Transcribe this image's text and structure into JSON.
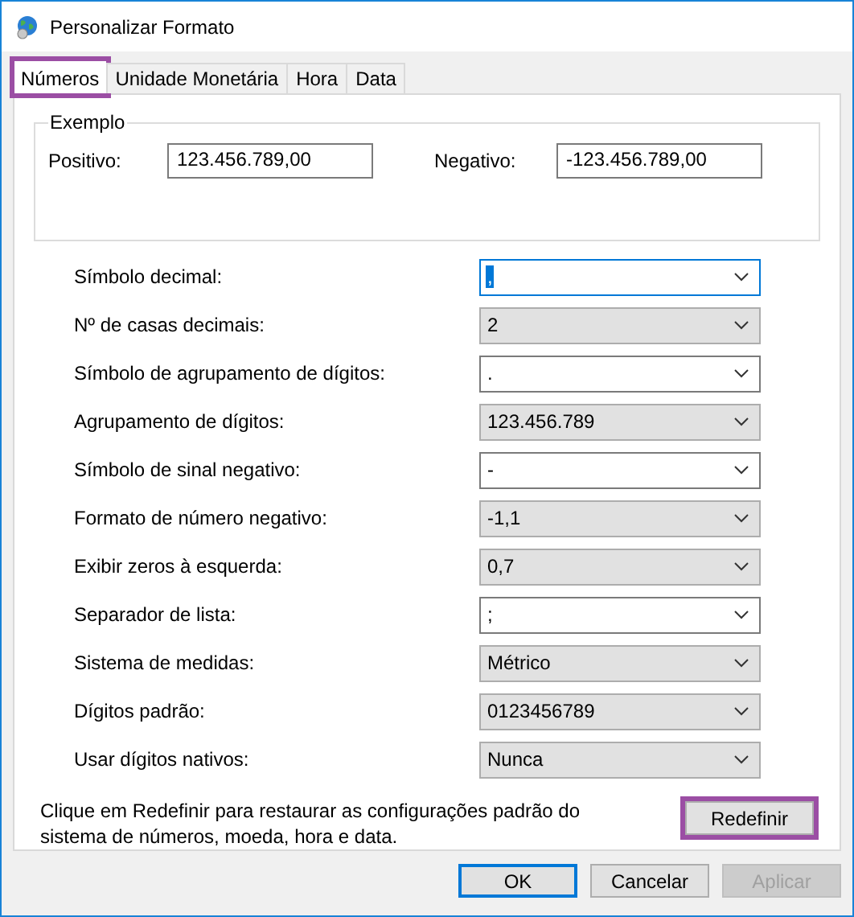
{
  "window": {
    "title": "Personalizar Formato"
  },
  "tabs": [
    {
      "label": "Números",
      "selected": true,
      "highlighted": true
    },
    {
      "label": "Unidade Monetária",
      "selected": false,
      "highlighted": false
    },
    {
      "label": "Hora",
      "selected": false,
      "highlighted": false
    },
    {
      "label": "Data",
      "selected": false,
      "highlighted": false
    }
  ],
  "example": {
    "title": "Exemplo",
    "positive_label": "Positivo:",
    "positive_value": "123.456.789,00",
    "negative_label": "Negativo:",
    "negative_value": "-123.456.789,00"
  },
  "settings": [
    {
      "label": "Símbolo decimal:",
      "value": ",",
      "editable": true,
      "focused": true
    },
    {
      "label": "Nº de casas decimais:",
      "value": "2",
      "editable": false,
      "focused": false
    },
    {
      "label": "Símbolo de agrupamento de dígitos:",
      "value": ".",
      "editable": true,
      "focused": false
    },
    {
      "label": "Agrupamento de dígitos:",
      "value": "123.456.789",
      "editable": false,
      "focused": false
    },
    {
      "label": "Símbolo de sinal negativo:",
      "value": "-",
      "editable": true,
      "focused": false
    },
    {
      "label": "Formato de número negativo:",
      "value": "-1,1",
      "editable": false,
      "focused": false
    },
    {
      "label": "Exibir zeros à esquerda:",
      "value": "0,7",
      "editable": false,
      "focused": false
    },
    {
      "label": "Separador de lista:",
      "value": ";",
      "editable": true,
      "focused": false
    },
    {
      "label": "Sistema de medidas:",
      "value": "Métrico",
      "editable": false,
      "focused": false
    },
    {
      "label": "Dígitos padrão:",
      "value": "0123456789",
      "editable": false,
      "focused": false
    },
    {
      "label": "Usar dígitos nativos:",
      "value": "Nunca",
      "editable": false,
      "focused": false
    }
  ],
  "reset": {
    "text": "Clique em Redefinir para restaurar as configurações padrão do sistema de números, moeda, hora e data.",
    "button": "Redefinir",
    "highlighted": true
  },
  "buttons": [
    {
      "label": "OK",
      "default": true,
      "disabled": false
    },
    {
      "label": "Cancelar",
      "default": false,
      "disabled": false
    },
    {
      "label": "Aplicar",
      "default": false,
      "disabled": true
    }
  ]
}
